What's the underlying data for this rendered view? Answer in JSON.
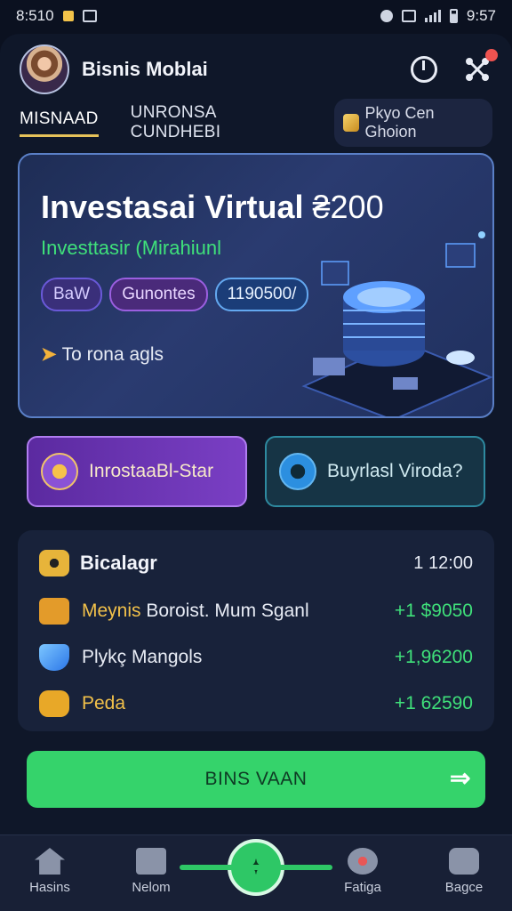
{
  "status_bar": {
    "time_left": "8:510",
    "time_right": "9:57"
  },
  "header": {
    "title": "Bisnis Moblai"
  },
  "tabs": [
    {
      "label": "MISNAAD",
      "active": true
    },
    {
      "label": "UNRONSA CUNDHEBI",
      "active": false
    }
  ],
  "tab_chip": {
    "label": "Pkyo Cen Ghoion"
  },
  "hero": {
    "title": "Investasai Virtual",
    "amount": "₴200",
    "subtitle": "Investtasir (Mirahiunl",
    "badges": [
      "BaW",
      "Gunontes",
      "1190500/"
    ],
    "link": "To rona agls"
  },
  "actions": [
    {
      "label": "InrostaaBl-Star"
    },
    {
      "label": "Buyrlasl Viroda?"
    }
  ],
  "panel": {
    "title": "Bicalagr",
    "time": "1  12:00",
    "rows": [
      {
        "label_highlight": "Meynis",
        "label_rest": " Boroist. Mum Sganl",
        "value": "+1 $9050"
      },
      {
        "label_highlight": "",
        "label_rest": "Plykç Mangols",
        "value": "+1,96200"
      },
      {
        "label_highlight": "Peda",
        "label_rest": "",
        "value": "+1 62590"
      }
    ]
  },
  "cta": {
    "label": "BINS VAAN"
  },
  "nav": [
    {
      "label": "Hasins"
    },
    {
      "label": "Nelom"
    },
    {
      "label": "Fatiga"
    },
    {
      "label": "Bagce"
    }
  ],
  "colors": {
    "accent_green": "#35d36b",
    "accent_purple": "#7a3fc4",
    "accent_gold": "#e6c25a"
  }
}
